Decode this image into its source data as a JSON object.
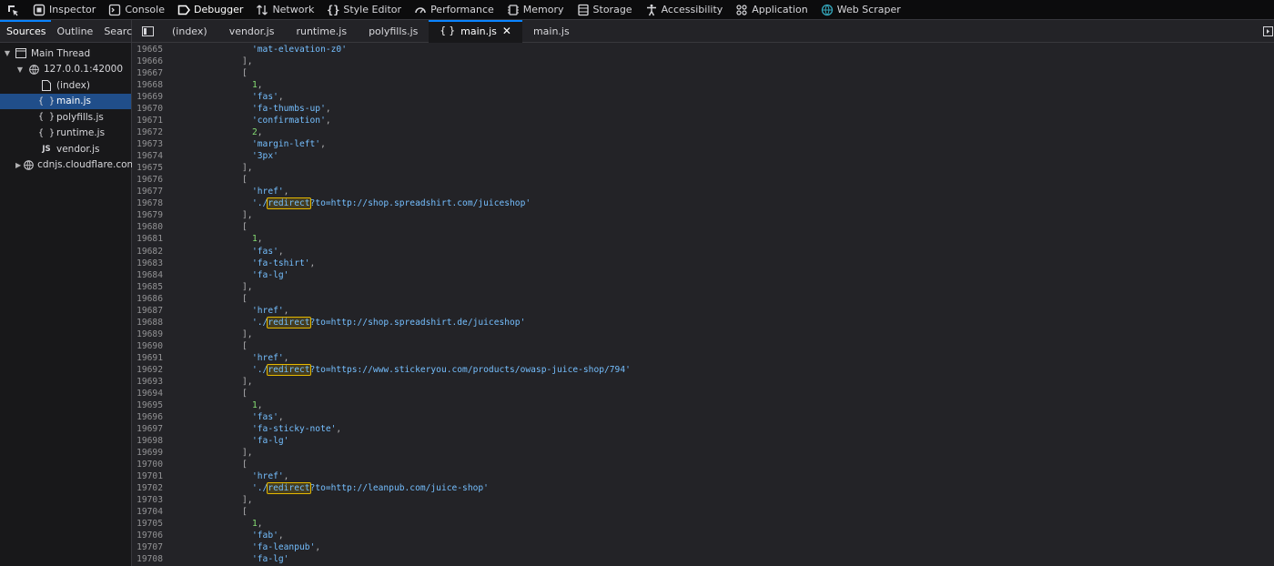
{
  "toolbar": {
    "tools": [
      {
        "name": "inspector",
        "label": "Inspector",
        "icon": "inspector-icon"
      },
      {
        "name": "console",
        "label": "Console",
        "icon": "console-icon"
      },
      {
        "name": "debugger",
        "label": "Debugger",
        "icon": "debugger-icon"
      },
      {
        "name": "network",
        "label": "Network",
        "icon": "network-icon"
      },
      {
        "name": "style-editor",
        "label": "Style Editor",
        "icon": "style-editor-icon"
      },
      {
        "name": "performance",
        "label": "Performance",
        "icon": "performance-icon"
      },
      {
        "name": "memory",
        "label": "Memory",
        "icon": "memory-icon"
      },
      {
        "name": "storage",
        "label": "Storage",
        "icon": "storage-icon"
      },
      {
        "name": "accessibility",
        "label": "Accessibility",
        "icon": "accessibility-icon"
      },
      {
        "name": "application",
        "label": "Application",
        "icon": "application-icon"
      },
      {
        "name": "web-scraper",
        "label": "Web Scraper",
        "icon": "web-scraper-icon"
      }
    ],
    "active": "debugger"
  },
  "left_panel": {
    "tabs": [
      "Sources",
      "Outline",
      "Search"
    ],
    "active_tab": "Sources",
    "tree": [
      {
        "label": "Main Thread",
        "depth": 0,
        "icon": "window-icon",
        "twisty": "open"
      },
      {
        "label": "127.0.0.1:42000",
        "depth": 1,
        "icon": "globe-icon",
        "twisty": "open"
      },
      {
        "label": "(index)",
        "depth": 2,
        "icon": "file-icon",
        "twisty": "none"
      },
      {
        "label": "main.js",
        "depth": 2,
        "icon": "braces-icon",
        "twisty": "none",
        "selected": true
      },
      {
        "label": "polyfills.js",
        "depth": 2,
        "icon": "braces-icon",
        "twisty": "none"
      },
      {
        "label": "runtime.js",
        "depth": 2,
        "icon": "braces-icon",
        "twisty": "none"
      },
      {
        "label": "vendor.js",
        "depth": 2,
        "icon": "js-icon",
        "twisty": "none"
      },
      {
        "label": "cdnjs.cloudflare.com",
        "depth": 1,
        "icon": "globe-icon",
        "twisty": "closed"
      }
    ]
  },
  "editor_tabs": [
    {
      "label": "(index)",
      "active": false
    },
    {
      "label": "vendor.js",
      "active": false
    },
    {
      "label": "runtime.js",
      "active": false
    },
    {
      "label": "polyfills.js",
      "active": false
    },
    {
      "label": "main.js",
      "active": true,
      "pretty": true
    },
    {
      "label": "main.js",
      "active": false
    }
  ],
  "code_lines": [
    {
      "n": "19665",
      "indent": 2,
      "parts": [
        [
          "str2",
          "'mat-elevation-z0'"
        ]
      ]
    },
    {
      "n": "19666",
      "indent": 1,
      "parts": [
        [
          "pun",
          "],"
        ]
      ]
    },
    {
      "n": "19667",
      "indent": 1,
      "parts": [
        [
          "pun",
          "["
        ]
      ]
    },
    {
      "n": "19668",
      "indent": 2,
      "parts": [
        [
          "num",
          "1"
        ],
        [
          "pun",
          ","
        ]
      ]
    },
    {
      "n": "19669",
      "indent": 2,
      "parts": [
        [
          "str2",
          "'fas'"
        ],
        [
          "pun",
          ","
        ]
      ]
    },
    {
      "n": "19670",
      "indent": 2,
      "parts": [
        [
          "str2",
          "'fa-thumbs-up'"
        ],
        [
          "pun",
          ","
        ]
      ]
    },
    {
      "n": "19671",
      "indent": 2,
      "parts": [
        [
          "str2",
          "'confirmation'"
        ],
        [
          "pun",
          ","
        ]
      ]
    },
    {
      "n": "19672",
      "indent": 2,
      "parts": [
        [
          "num",
          "2"
        ],
        [
          "pun",
          ","
        ]
      ]
    },
    {
      "n": "19673",
      "indent": 2,
      "parts": [
        [
          "str2",
          "'margin-left'"
        ],
        [
          "pun",
          ","
        ]
      ]
    },
    {
      "n": "19674",
      "indent": 2,
      "parts": [
        [
          "str2",
          "'3px'"
        ]
      ]
    },
    {
      "n": "19675",
      "indent": 1,
      "parts": [
        [
          "pun",
          "],"
        ]
      ]
    },
    {
      "n": "19676",
      "indent": 1,
      "parts": [
        [
          "pun",
          "["
        ]
      ]
    },
    {
      "n": "19677",
      "indent": 2,
      "parts": [
        [
          "str2",
          "'href'"
        ],
        [
          "pun",
          ","
        ]
      ]
    },
    {
      "n": "19678",
      "indent": 2,
      "parts": [
        [
          "str2",
          "'./"
        ],
        [
          "hl",
          "redirect"
        ],
        [
          "str2",
          "?to=http://shop.spreadshirt.com/juiceshop'"
        ]
      ]
    },
    {
      "n": "19679",
      "indent": 1,
      "parts": [
        [
          "pun",
          "],"
        ]
      ]
    },
    {
      "n": "19680",
      "indent": 1,
      "parts": [
        [
          "pun",
          "["
        ]
      ]
    },
    {
      "n": "19681",
      "indent": 2,
      "parts": [
        [
          "num",
          "1"
        ],
        [
          "pun",
          ","
        ]
      ]
    },
    {
      "n": "19682",
      "indent": 2,
      "parts": [
        [
          "str2",
          "'fas'"
        ],
        [
          "pun",
          ","
        ]
      ]
    },
    {
      "n": "19683",
      "indent": 2,
      "parts": [
        [
          "str2",
          "'fa-tshirt'"
        ],
        [
          "pun",
          ","
        ]
      ]
    },
    {
      "n": "19684",
      "indent": 2,
      "parts": [
        [
          "str2",
          "'fa-lg'"
        ]
      ]
    },
    {
      "n": "19685",
      "indent": 1,
      "parts": [
        [
          "pun",
          "],"
        ]
      ]
    },
    {
      "n": "19686",
      "indent": 1,
      "parts": [
        [
          "pun",
          "["
        ]
      ]
    },
    {
      "n": "19687",
      "indent": 2,
      "parts": [
        [
          "str2",
          "'href'"
        ],
        [
          "pun",
          ","
        ]
      ]
    },
    {
      "n": "19688",
      "indent": 2,
      "parts": [
        [
          "str2",
          "'./"
        ],
        [
          "hl",
          "redirect"
        ],
        [
          "str2",
          "?to=http://shop.spreadshirt.de/juiceshop'"
        ]
      ]
    },
    {
      "n": "19689",
      "indent": 1,
      "parts": [
        [
          "pun",
          "],"
        ]
      ]
    },
    {
      "n": "19690",
      "indent": 1,
      "parts": [
        [
          "pun",
          "["
        ]
      ]
    },
    {
      "n": "19691",
      "indent": 2,
      "parts": [
        [
          "str2",
          "'href'"
        ],
        [
          "pun",
          ","
        ]
      ]
    },
    {
      "n": "19692",
      "indent": 2,
      "parts": [
        [
          "str2",
          "'./"
        ],
        [
          "hl",
          "redirect"
        ],
        [
          "str2",
          "?to=https://www.stickeryou.com/products/owasp-juice-shop/794'"
        ]
      ]
    },
    {
      "n": "19693",
      "indent": 1,
      "parts": [
        [
          "pun",
          "],"
        ]
      ]
    },
    {
      "n": "19694",
      "indent": 1,
      "parts": [
        [
          "pun",
          "["
        ]
      ]
    },
    {
      "n": "19695",
      "indent": 2,
      "parts": [
        [
          "num",
          "1"
        ],
        [
          "pun",
          ","
        ]
      ]
    },
    {
      "n": "19696",
      "indent": 2,
      "parts": [
        [
          "str2",
          "'fas'"
        ],
        [
          "pun",
          ","
        ]
      ]
    },
    {
      "n": "19697",
      "indent": 2,
      "parts": [
        [
          "str2",
          "'fa-sticky-note'"
        ],
        [
          "pun",
          ","
        ]
      ]
    },
    {
      "n": "19698",
      "indent": 2,
      "parts": [
        [
          "str2",
          "'fa-lg'"
        ]
      ]
    },
    {
      "n": "19699",
      "indent": 1,
      "parts": [
        [
          "pun",
          "],"
        ]
      ]
    },
    {
      "n": "19700",
      "indent": 1,
      "parts": [
        [
          "pun",
          "["
        ]
      ]
    },
    {
      "n": "19701",
      "indent": 2,
      "parts": [
        [
          "str2",
          "'href'"
        ],
        [
          "pun",
          ","
        ]
      ]
    },
    {
      "n": "19702",
      "indent": 2,
      "parts": [
        [
          "str2",
          "'./"
        ],
        [
          "hl",
          "redirect"
        ],
        [
          "str2",
          "?to=http://leanpub.com/juice-shop'"
        ]
      ]
    },
    {
      "n": "19703",
      "indent": 1,
      "parts": [
        [
          "pun",
          "],"
        ]
      ]
    },
    {
      "n": "19704",
      "indent": 1,
      "parts": [
        [
          "pun",
          "["
        ]
      ]
    },
    {
      "n": "19705",
      "indent": 2,
      "parts": [
        [
          "num",
          "1"
        ],
        [
          "pun",
          ","
        ]
      ]
    },
    {
      "n": "19706",
      "indent": 2,
      "parts": [
        [
          "str2",
          "'fab'"
        ],
        [
          "pun",
          ","
        ]
      ]
    },
    {
      "n": "19707",
      "indent": 2,
      "parts": [
        [
          "str2",
          "'fa-leanpub'"
        ],
        [
          "pun",
          ","
        ]
      ]
    },
    {
      "n": "19708",
      "indent": 2,
      "parts": [
        [
          "str2",
          "'fa-lg'"
        ]
      ]
    }
  ],
  "colors": {
    "string": "#75bfff",
    "highlight_outline": "#e5b800",
    "selected_row": "#204e8a",
    "accent": "#0a84ff"
  }
}
